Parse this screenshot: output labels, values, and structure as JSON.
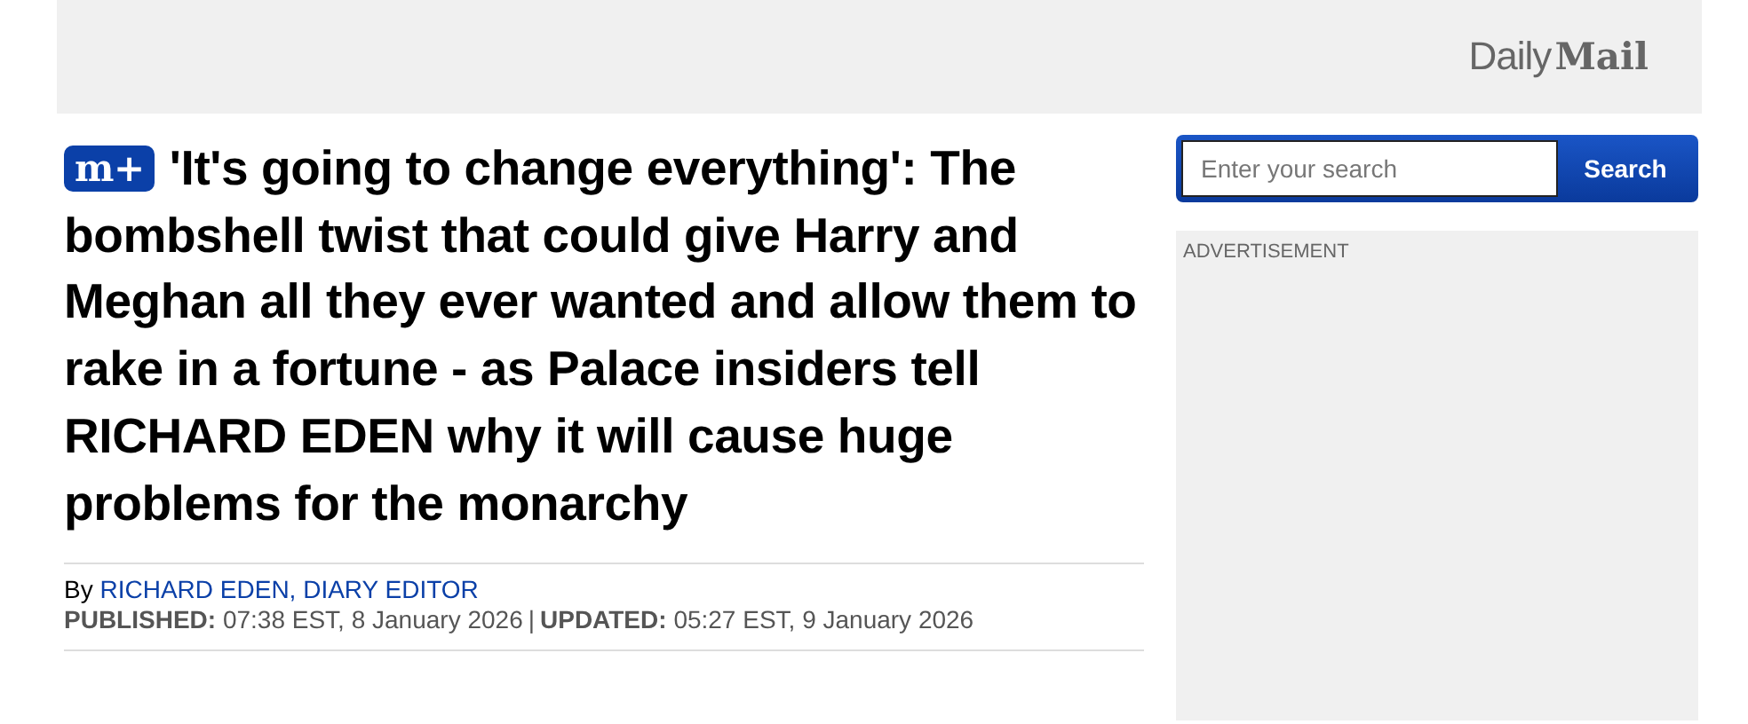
{
  "header": {
    "logo": {
      "light": "Daily",
      "heavy": "Mail"
    }
  },
  "article": {
    "badge": "m+",
    "headline": "'It's going to change everything': The bombshell twist that could give Harry and Meghan all they ever wanted and allow them to rake in a fortune - as Palace insiders tell RICHARD EDEN why it will cause huge problems for the monarchy",
    "byline": {
      "prefix": "By",
      "author": "RICHARD EDEN, DIARY EDITOR"
    },
    "published": {
      "label": "PUBLISHED:",
      "value": "07:38 EST, 8 January 2026"
    },
    "separator": "|",
    "updated": {
      "label": "UPDATED:",
      "value": "05:27 EST, 9 January 2026"
    }
  },
  "sidebar": {
    "search": {
      "placeholder": "Enter your search",
      "button": "Search"
    },
    "advertisement": {
      "label": "ADVERTISEMENT"
    }
  }
}
